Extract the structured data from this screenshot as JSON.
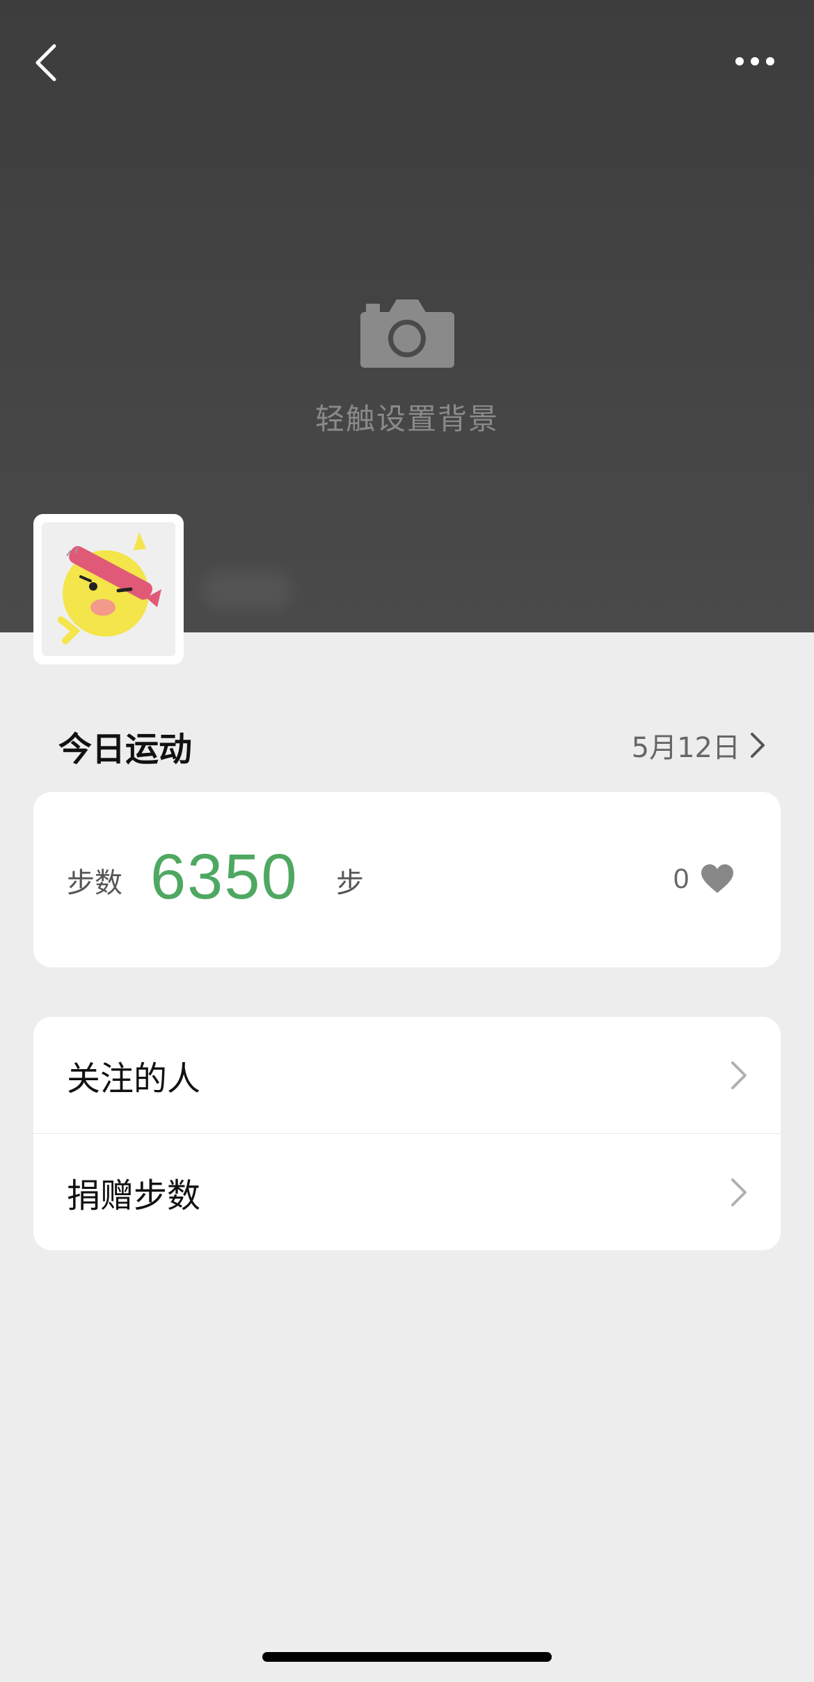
{
  "header": {
    "back_icon": "chevron-left-icon",
    "more_icon": "ellipsis-icon",
    "set_background_icon": "camera-icon",
    "set_background_label": "轻触设置背景",
    "colors": {
      "background": "#444444",
      "hint": "#8a8a8a"
    }
  },
  "profile": {
    "avatar": "avatar-image",
    "name_hidden": true
  },
  "today": {
    "title": "今日运动",
    "date": "5月12日",
    "date_icon": "chevron-right-icon"
  },
  "steps": {
    "label": "步数",
    "value": "6350",
    "unit": "步",
    "likes": "0",
    "like_icon": "heart-icon",
    "value_color": "#4fa861"
  },
  "menu": {
    "items": [
      {
        "label": "关注的人",
        "icon": "chevron-right-icon"
      },
      {
        "label": "捐赠步数",
        "icon": "chevron-right-icon"
      }
    ]
  }
}
